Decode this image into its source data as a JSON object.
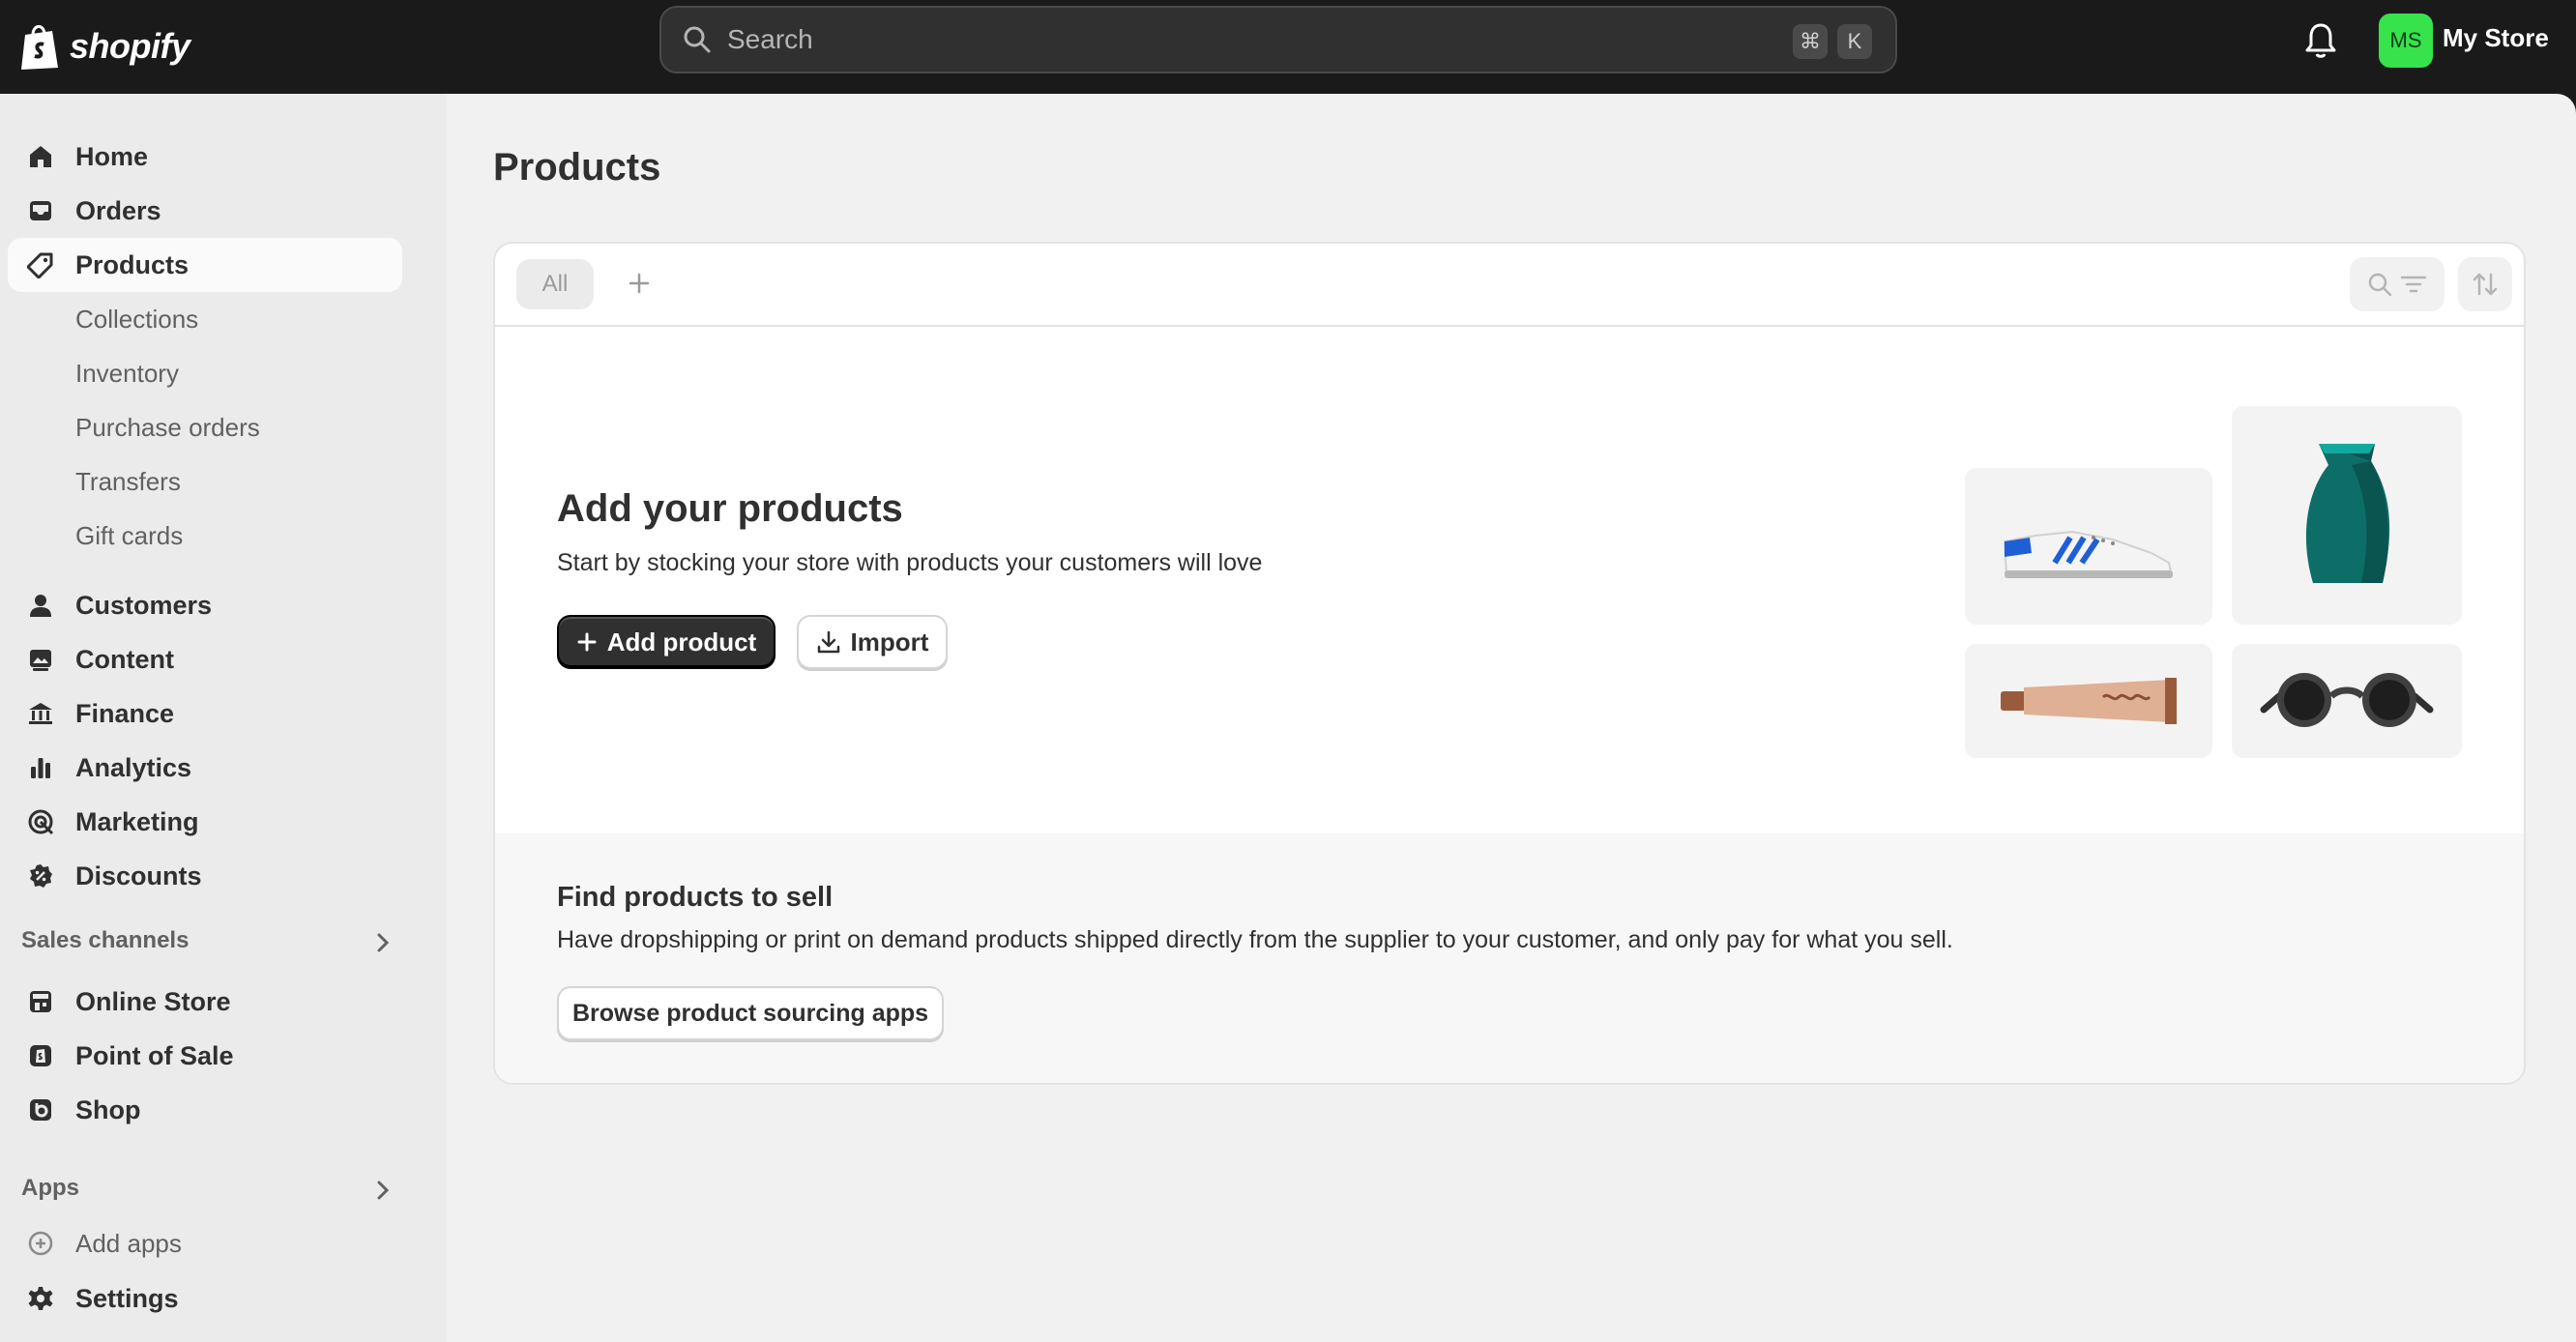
{
  "app": {
    "brand": "shopify",
    "store_name": "My Store",
    "avatar_initials": "MS",
    "avatar_color": "#36e34c"
  },
  "search": {
    "placeholder": "Search",
    "shortcut_keys": [
      "⌘",
      "K"
    ]
  },
  "sidebar": {
    "main_items": [
      {
        "label": "Home",
        "icon": "home-icon"
      },
      {
        "label": "Orders",
        "icon": "inbox-icon"
      },
      {
        "label": "Products",
        "icon": "tag-icon",
        "active": true
      }
    ],
    "product_subitems": [
      "Collections",
      "Inventory",
      "Purchase orders",
      "Transfers",
      "Gift cards"
    ],
    "more_items": [
      {
        "label": "Customers",
        "icon": "person-icon"
      },
      {
        "label": "Content",
        "icon": "image-icon"
      },
      {
        "label": "Finance",
        "icon": "bank-icon"
      },
      {
        "label": "Analytics",
        "icon": "bar-chart-icon"
      },
      {
        "label": "Marketing",
        "icon": "target-icon"
      },
      {
        "label": "Discounts",
        "icon": "discount-icon"
      }
    ],
    "sales_channels": {
      "title": "Sales channels",
      "items": [
        {
          "label": "Online Store",
          "icon": "storefront-icon"
        },
        {
          "label": "Point of Sale",
          "icon": "pos-icon"
        },
        {
          "label": "Shop",
          "icon": "shop-icon"
        }
      ]
    },
    "apps": {
      "title": "Apps",
      "add_label": "Add apps"
    },
    "settings_label": "Settings"
  },
  "main": {
    "page_title": "Products",
    "tabs": {
      "all_label": "All"
    },
    "empty_state": {
      "title": "Add your products",
      "subtitle": "Start by stocking your store with products your customers will love",
      "add_product_label": "Add product",
      "import_label": "Import"
    },
    "find_products": {
      "title": "Find products to sell",
      "subtitle": "Have dropshipping or print on demand products shipped directly from the supplier to your customer, and only pay for what you sell.",
      "button_label": "Browse product sourcing apps"
    }
  },
  "colors": {
    "topbar": "#1a1a1a",
    "sidebar": "#ebebeb",
    "main_bg": "#f1f1f1",
    "primary_button": "#303030"
  }
}
